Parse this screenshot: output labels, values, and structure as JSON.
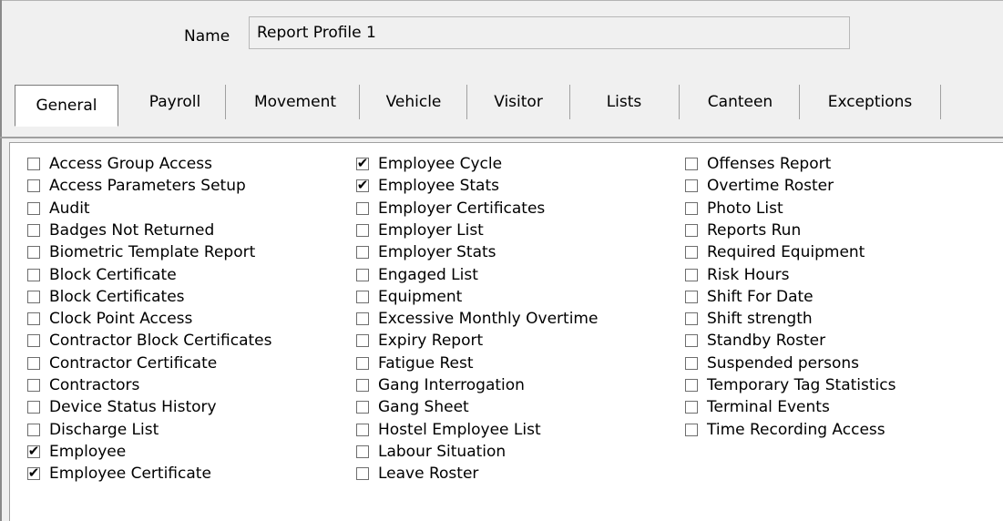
{
  "name_field": {
    "label": "Name",
    "value": "Report Profile 1"
  },
  "tabs": [
    {
      "label": "General",
      "active": true
    },
    {
      "label": "Payroll",
      "active": false
    },
    {
      "label": "Movement",
      "active": false
    },
    {
      "label": "Vehicle",
      "active": false
    },
    {
      "label": "Visitor",
      "active": false
    },
    {
      "label": "Lists",
      "active": false
    },
    {
      "label": "Canteen",
      "active": false
    },
    {
      "label": "Exceptions",
      "active": false
    }
  ],
  "columns": [
    [
      {
        "label": "Access Group Access",
        "checked": false
      },
      {
        "label": "Access Parameters Setup",
        "checked": false
      },
      {
        "label": "Audit",
        "checked": false
      },
      {
        "label": "Badges Not Returned",
        "checked": false
      },
      {
        "label": "Biometric Template Report",
        "checked": false
      },
      {
        "label": "Block Certificate",
        "checked": false
      },
      {
        "label": "Block Certificates",
        "checked": false
      },
      {
        "label": "Clock Point Access",
        "checked": false
      },
      {
        "label": "Contractor Block Certificates",
        "checked": false
      },
      {
        "label": "Contractor Certificate",
        "checked": false
      },
      {
        "label": "Contractors",
        "checked": false
      },
      {
        "label": "Device Status History",
        "checked": false
      },
      {
        "label": "Discharge List",
        "checked": false
      },
      {
        "label": "Employee",
        "checked": true
      },
      {
        "label": "Employee Certificate",
        "checked": true
      }
    ],
    [
      {
        "label": "Employee Cycle",
        "checked": true
      },
      {
        "label": "Employee Stats",
        "checked": true
      },
      {
        "label": "Employer Certificates",
        "checked": false
      },
      {
        "label": "Employer List",
        "checked": false
      },
      {
        "label": "Employer Stats",
        "checked": false
      },
      {
        "label": "Engaged List",
        "checked": false
      },
      {
        "label": "Equipment",
        "checked": false
      },
      {
        "label": "Excessive Monthly Overtime",
        "checked": false
      },
      {
        "label": "Expiry Report",
        "checked": false
      },
      {
        "label": "Fatigue Rest",
        "checked": false
      },
      {
        "label": "Gang Interrogation",
        "checked": false
      },
      {
        "label": "Gang Sheet",
        "checked": false
      },
      {
        "label": "Hostel Employee List",
        "checked": false
      },
      {
        "label": "Labour Situation",
        "checked": false
      },
      {
        "label": "Leave Roster",
        "checked": false
      }
    ],
    [
      {
        "label": "Offenses Report",
        "checked": false
      },
      {
        "label": "Overtime Roster",
        "checked": false
      },
      {
        "label": "Photo List",
        "checked": false
      },
      {
        "label": "Reports Run",
        "checked": false
      },
      {
        "label": "Required Equipment",
        "checked": false
      },
      {
        "label": "Risk Hours",
        "checked": false
      },
      {
        "label": "Shift For Date",
        "checked": false
      },
      {
        "label": "Shift strength",
        "checked": false
      },
      {
        "label": "Standby Roster",
        "checked": false
      },
      {
        "label": "Suspended persons",
        "checked": false
      },
      {
        "label": "Temporary Tag Statistics",
        "checked": false
      },
      {
        "label": "Terminal Events",
        "checked": false
      },
      {
        "label": "Time Recording Access",
        "checked": false
      }
    ]
  ],
  "check_glyph": "✔"
}
